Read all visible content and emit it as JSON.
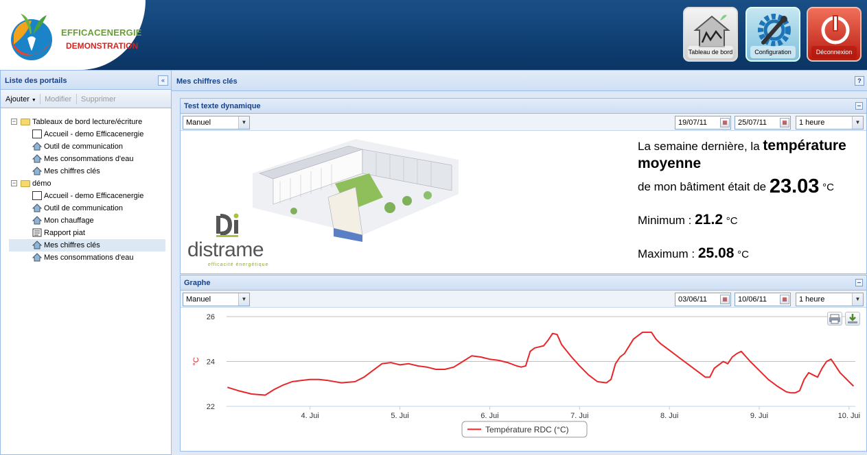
{
  "brand": {
    "title": "EFFICACENERGIE",
    "subtitle": "DEMONSTRATION"
  },
  "header_buttons": [
    {
      "label": "Tableau de bord",
      "icon": "house-chart-icon"
    },
    {
      "label": "Configuration",
      "icon": "gear-wrench-icon"
    },
    {
      "label": "Déconnexion",
      "icon": "power-icon"
    }
  ],
  "left_panel": {
    "title": "Liste des portails",
    "toolbar": {
      "add": "Ajouter",
      "edit": "Modifier",
      "delete": "Supprimer"
    },
    "tree": [
      {
        "label": "Tableaux de bord lecture/écriture",
        "type": "folder",
        "children": [
          {
            "label": "Accueil - demo Efficacenergie",
            "icon": "chart-icon"
          },
          {
            "label": "Outil de communication",
            "icon": "house-icon"
          },
          {
            "label": "Mes consommations d'eau",
            "icon": "house-icon"
          },
          {
            "label": "Mes chiffres clés",
            "icon": "house-icon"
          }
        ]
      },
      {
        "label": "démo",
        "type": "folder",
        "children": [
          {
            "label": "Accueil - demo Efficacenergie",
            "icon": "chart-icon"
          },
          {
            "label": "Outil de communication",
            "icon": "house-icon"
          },
          {
            "label": "Mon chauffage",
            "icon": "house-icon"
          },
          {
            "label": "Rapport piat",
            "icon": "report-icon"
          },
          {
            "label": "Mes chiffres clés",
            "icon": "house-icon",
            "selected": true
          },
          {
            "label": "Mes consommations d'eau",
            "icon": "house-icon"
          }
        ]
      }
    ]
  },
  "main": {
    "title": "Mes chiffres clés",
    "help": "?"
  },
  "widget_text": {
    "title": "Test texte dynamique",
    "mode": "Manuel",
    "date_from": "19/07/11",
    "date_to": "25/07/11",
    "step": "1 heure",
    "logo_text": "distrame",
    "logo_tagline": "efficacité énergétique",
    "line1_pre": "La semaine dernière, la ",
    "line1_bold": "température",
    "line2_bold": "moyenne",
    "line3_pre": "de mon bâtiment était de ",
    "avg_value": "23.03",
    "unit": "°C",
    "min_label": "Minimum : ",
    "min_value": "21.2",
    "max_label": "Maximum : ",
    "max_value": "25.08"
  },
  "widget_graph": {
    "title": "Graphe",
    "mode": "Manuel",
    "date_from": "03/06/11",
    "date_to": "10/06/11",
    "step": "1 heure"
  },
  "chart_data": {
    "type": "line",
    "title": "",
    "xlabel": "",
    "ylabel": "°C",
    "ylim": [
      22,
      26
    ],
    "xlim": [
      3.07,
      10.07
    ],
    "yticks": [
      22,
      24,
      26
    ],
    "xticks": [
      4,
      5,
      6,
      7,
      8,
      9,
      10
    ],
    "xtick_labels": [
      "4. Jui",
      "5. Jui",
      "6. Jui",
      "7. Jui",
      "8. Jui",
      "9. Jui",
      "10. Jui"
    ],
    "grid": "horizontal",
    "legend": "bottom-center",
    "colors": {
      "series": "#e8262a",
      "grid": "#c0c0c0"
    },
    "series": [
      {
        "name": "Température RDC (°C)",
        "x": [
          3.08,
          3.2,
          3.35,
          3.5,
          3.6,
          3.7,
          3.8,
          3.9,
          4.0,
          4.1,
          4.2,
          4.35,
          4.5,
          4.6,
          4.7,
          4.8,
          4.9,
          4.95,
          5.0,
          5.1,
          5.2,
          5.3,
          5.4,
          5.5,
          5.6,
          5.7,
          5.8,
          5.9,
          5.95,
          6.0,
          6.1,
          6.2,
          6.3,
          6.35,
          6.4,
          6.45,
          6.5,
          6.55,
          6.6,
          6.65,
          6.7,
          6.75,
          6.8,
          6.9,
          7.0,
          7.1,
          7.2,
          7.3,
          7.35,
          7.4,
          7.45,
          7.5,
          7.6,
          7.7,
          7.75,
          7.8,
          7.85,
          7.9,
          8.0,
          8.1,
          8.2,
          8.3,
          8.4,
          8.45,
          8.5,
          8.55,
          8.6,
          8.65,
          8.7,
          8.75,
          8.8,
          8.9,
          9.0,
          9.1,
          9.2,
          9.3,
          9.35,
          9.4,
          9.45,
          9.5,
          9.55,
          9.6,
          9.65,
          9.7,
          9.75,
          9.8,
          9.9,
          10.0,
          10.05
        ],
        "y": [
          22.85,
          22.7,
          22.55,
          22.5,
          22.75,
          22.95,
          23.1,
          23.15,
          23.2,
          23.2,
          23.15,
          23.05,
          23.1,
          23.3,
          23.6,
          23.9,
          23.95,
          23.9,
          23.85,
          23.9,
          23.8,
          23.75,
          23.65,
          23.65,
          23.75,
          24.0,
          24.25,
          24.2,
          24.15,
          24.1,
          24.05,
          23.95,
          23.8,
          23.75,
          23.8,
          24.45,
          24.6,
          24.65,
          24.7,
          24.95,
          25.25,
          25.2,
          24.75,
          24.25,
          23.8,
          23.4,
          23.1,
          23.05,
          23.2,
          23.9,
          24.2,
          24.35,
          25.0,
          25.3,
          25.3,
          25.3,
          25.0,
          24.8,
          24.5,
          24.2,
          23.9,
          23.6,
          23.3,
          23.3,
          23.7,
          23.85,
          24.0,
          23.9,
          24.2,
          24.35,
          24.45,
          24.0,
          23.6,
          23.2,
          22.9,
          22.65,
          22.6,
          22.6,
          22.7,
          23.2,
          23.5,
          23.4,
          23.3,
          23.7,
          24.0,
          24.1,
          23.5,
          23.1,
          22.9
        ]
      }
    ]
  }
}
